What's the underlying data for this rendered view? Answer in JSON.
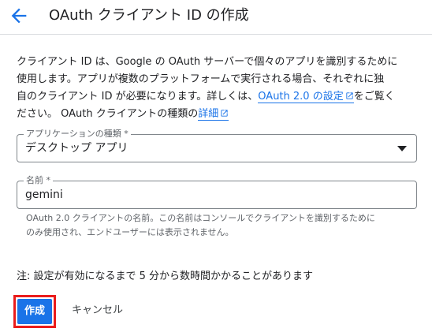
{
  "header": {
    "back_icon": "arrow-back-icon",
    "title": "OAuth クライアント ID の作成"
  },
  "description": {
    "line1": "クライアント ID は、Google の OAuth サーバーで個々のアプリを識別するために",
    "line2": "使用します。アプリが複数のプラットフォームで実行される場合、それぞれに独",
    "line3_before": "自のクライアント ID が必要になります。詳しくは、",
    "link_settings": "OAuth 2.0 の設定",
    "line3_after": "をご覧く",
    "line4_before": "ださい。 OAuth クライアントの種類の",
    "link_details": "詳細",
    "external_link_icon": "open-in-new-icon"
  },
  "app_type_field": {
    "label": "アプリケーションの種類 *",
    "value": "デスクトップ アプリ",
    "dropdown_icon": "arrow-drop-down-icon"
  },
  "name_field": {
    "label": "名前 *",
    "value": "gemini",
    "hint_line1": "OAuth 2.0 クライアントの名前。この名前はコンソールでクライアントを識別するために",
    "hint_line2": "のみ使用され、エンドユーザーには表示されません。"
  },
  "note": "注: 設定が有効になるまで 5 分から数時間かかることがあります",
  "actions": {
    "create_label": "作成",
    "cancel_label": "キャンセル"
  },
  "colors": {
    "primary": "#1a73e8",
    "highlight_border": "#ea1c1c",
    "text": "#202124",
    "secondary_text": "#5f6368"
  }
}
